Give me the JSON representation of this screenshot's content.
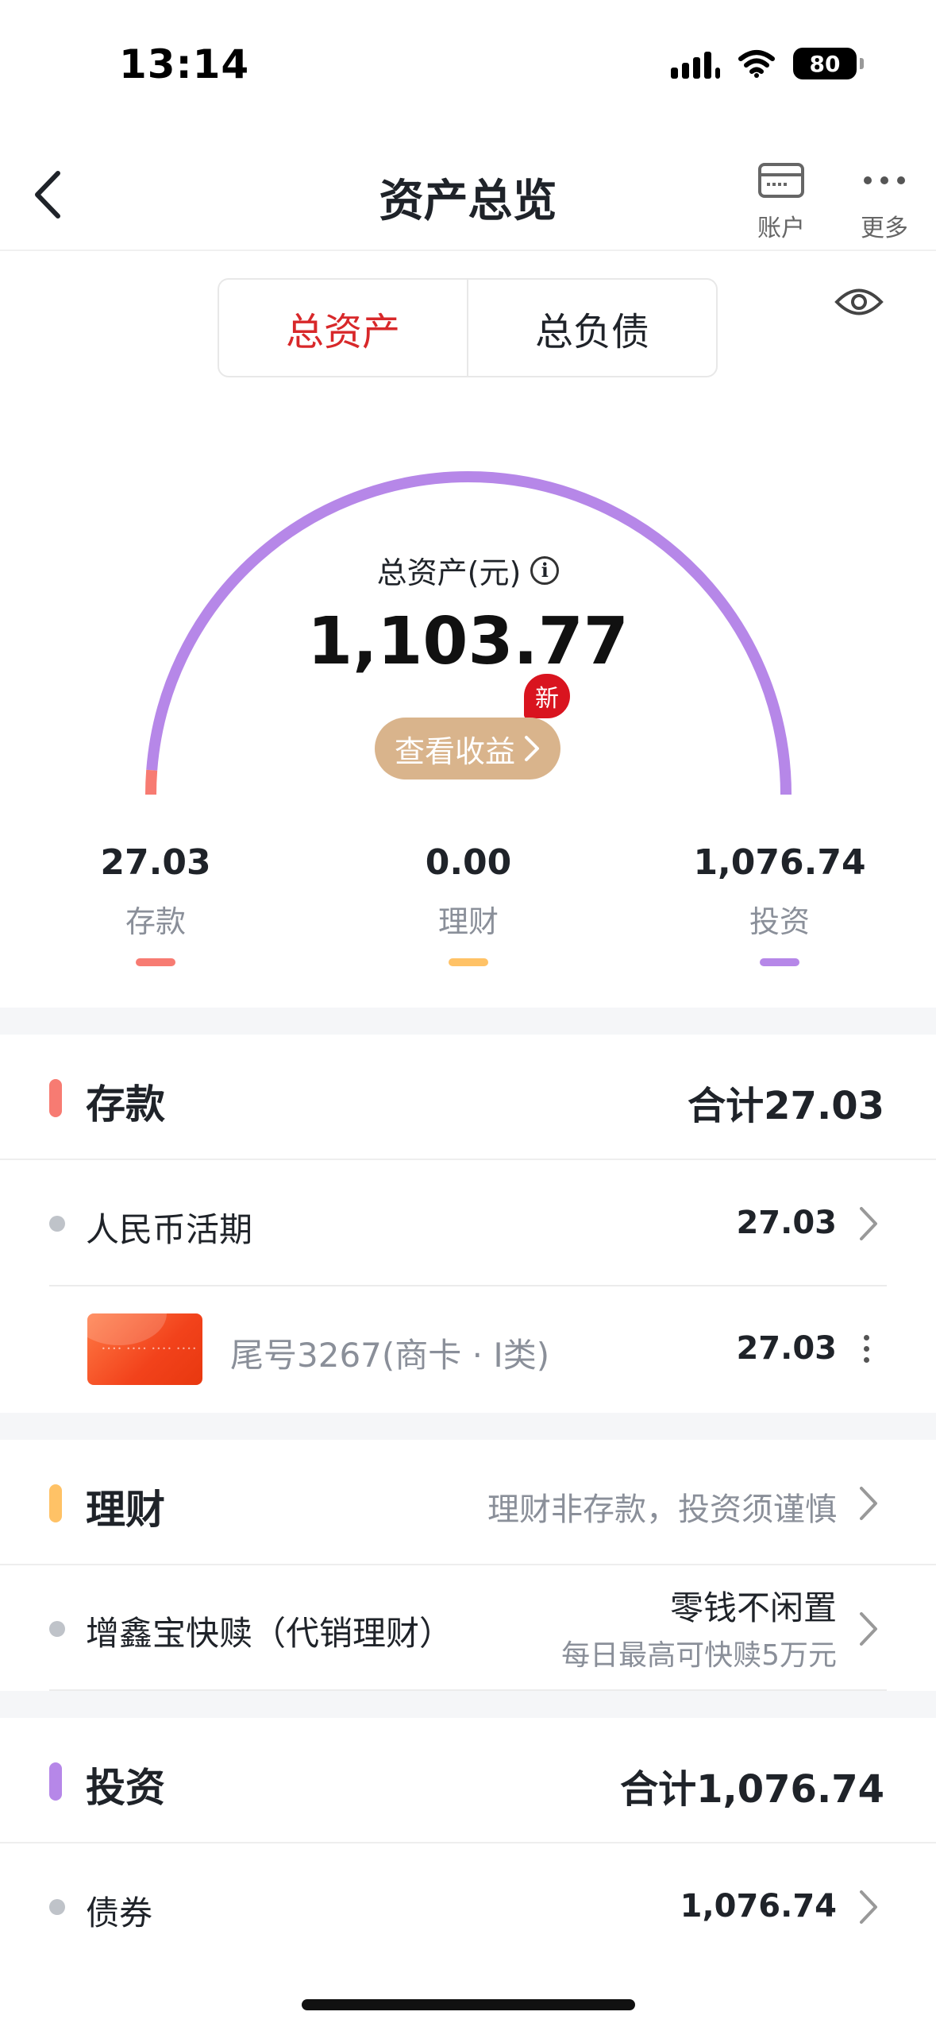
{
  "status": {
    "time": "13:14",
    "battery": "80"
  },
  "nav": {
    "title": "资产总览",
    "account_label": "账户",
    "more_label": "更多"
  },
  "segment": {
    "tab_assets": "总资产",
    "tab_liabilities": "总负债"
  },
  "gauge": {
    "label": "总资产(元)",
    "value": "1,103.77",
    "new_badge": "新",
    "earnings_button": "查看收益",
    "share_deposit": 0.0245,
    "share_wealth": 0.0,
    "share_invest": 0.9755
  },
  "legend": [
    {
      "value": "27.03",
      "label": "存款"
    },
    {
      "value": "0.00",
      "label": "理财"
    },
    {
      "value": "1,076.74",
      "label": "投资"
    }
  ],
  "colors": {
    "deposit": "#f77b72",
    "wealth": "#ffc266",
    "invest": "#b687e8",
    "accent": "#d8282a",
    "earnings": "#d9b48c"
  },
  "deposit": {
    "title": "存款",
    "total": "合计27.03",
    "items": [
      {
        "name": "人民币活期",
        "amount": "27.03"
      }
    ],
    "card": {
      "name": "尾号3267(商卡 · I类)",
      "amount": "27.03"
    }
  },
  "wealth": {
    "title": "理财",
    "hint": "理财非存款，投资须谨慎",
    "items": [
      {
        "name": "增鑫宝快赎（代销理财）",
        "tagline": "零钱不闲置",
        "subline": "每日最高可快赎5万元"
      }
    ]
  },
  "invest": {
    "title": "投资",
    "total": "合计1,076.74",
    "items": [
      {
        "name": "债券",
        "amount": "1,076.74"
      }
    ]
  }
}
